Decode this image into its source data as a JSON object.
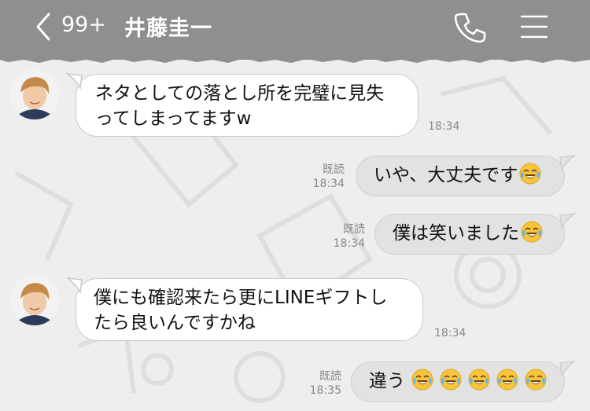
{
  "header": {
    "unread_count": "99+",
    "contact_name": "井藤圭一"
  },
  "messages": [
    {
      "side": "left",
      "lines": [
        "ネタとしての落とし所を完璧に見失",
        "ってしまってますw"
      ],
      "time": "18:34"
    },
    {
      "side": "right",
      "text": "いや、大丈夫です",
      "emoji_count": 1,
      "read": "既読",
      "time": "18:34"
    },
    {
      "side": "right",
      "text": "僕は笑いました",
      "emoji_count": 1,
      "read": "既読",
      "time": "18:34"
    },
    {
      "side": "left",
      "lines": [
        "僕にも確認来たら更にLINEギフトし",
        "たら良いんですかね"
      ],
      "time": "18:34"
    },
    {
      "side": "right",
      "text": "違う",
      "emoji_count": 5,
      "read": "既読",
      "time": "18:35"
    }
  ],
  "icons": {
    "back": "chevron-left-icon",
    "phone": "phone-icon",
    "menu": "hamburger-menu-icon",
    "emoji": "face-with-tears-of-joy-emoji"
  },
  "colors": {
    "header": "#8f8f8f",
    "background": "#eeeeee",
    "left_bubble": "#ffffff",
    "right_bubble": "#e2e2e2",
    "meta_text": "#888888"
  }
}
